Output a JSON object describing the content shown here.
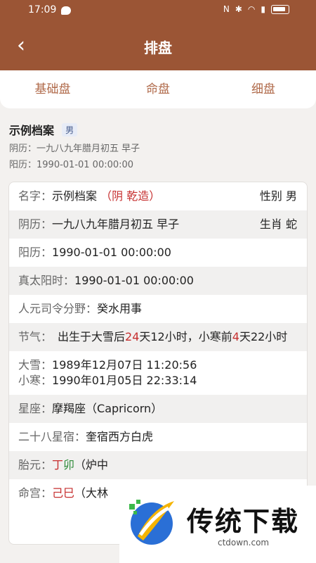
{
  "status": {
    "time": "17:09",
    "icons": [
      "chat-icon",
      "nfc-icon",
      "bluetooth-icon",
      "wifi-icon",
      "signal-icon",
      "battery-icon"
    ]
  },
  "header": {
    "title": "排盘"
  },
  "tabs": [
    "基础盘",
    "命盘",
    "细盘"
  ],
  "profile": {
    "name": "示例档案",
    "gender": "男",
    "lunar": "阴历：一九八九年腊月初五 早子",
    "solar": "阳历：1990-01-01 00:00:00"
  },
  "details": {
    "name_label": "名字：",
    "name_value": "示例档案",
    "name_tag": "（阴 乾造）",
    "gender_label": "性别",
    "gender_value": "男",
    "lunar_label": "阴历：",
    "lunar_value": "一九八九年腊月初五 早子",
    "zodiac_label": "生肖",
    "zodiac_value": "蛇",
    "solar_label": "阳历：",
    "solar_value": "1990-01-01 00:00:00",
    "true_solar_label": "真太阳时：",
    "true_solar_value": "1990-01-01 00:00:00",
    "renyuan_label": "人元司令分野：",
    "renyuan_value": "癸水用事",
    "jieqi_label": "节气：",
    "jieqi_pre": "出生于大雪后",
    "jieqi_days1": "24",
    "jieqi_mid": "天12小时，小寒前",
    "jieqi_days2": "4",
    "jieqi_post": "天22小时",
    "daxue_label": "大雪：",
    "daxue_value": "1989年12月07日 11:20:56",
    "xiaohan_label": "小寒：",
    "xiaohan_value": "1990年01月05日 22:33:14",
    "constellation_label": "星座：",
    "constellation_value": "摩羯座（Capricorn）",
    "mansion_label": "二十八星宿：",
    "mansion_value": "奎宿西方白虎",
    "taiyuan_label": "胎元：",
    "taiyuan_g1": "丁",
    "taiyuan_g2": "卯",
    "taiyuan_rest": "（炉中",
    "minggong_label": "命宫：",
    "minggong_g1": "己",
    "minggong_g2": "巳",
    "minggong_rest": "（大林"
  },
  "watermark": {
    "brand": "传统下载",
    "url": "ctdown.com"
  }
}
